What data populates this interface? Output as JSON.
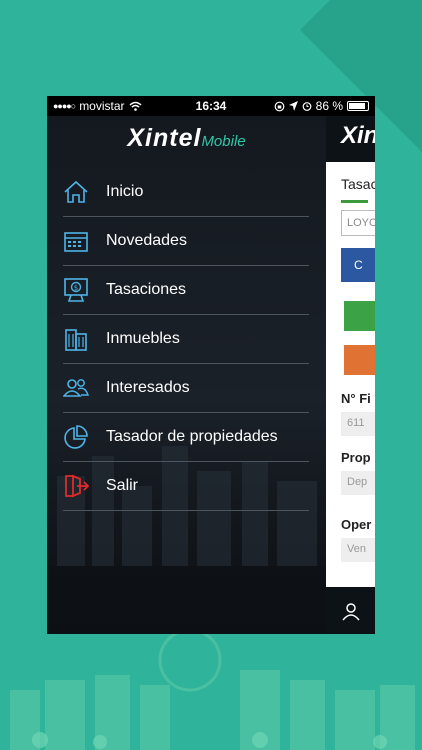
{
  "status_bar": {
    "signal_dots": "●●●●○",
    "carrier": "movistar",
    "time": "16:34",
    "battery_percent": "86 %"
  },
  "app": {
    "brand": "Xintel",
    "brand_sub": "Mobile"
  },
  "menu": {
    "items": [
      {
        "label": "Inicio",
        "icon": "home-icon"
      },
      {
        "label": "Novedades",
        "icon": "calendar-icon"
      },
      {
        "label": "Tasaciones",
        "icon": "appraisal-icon"
      },
      {
        "label": "Inmuebles",
        "icon": "building-icon"
      },
      {
        "label": "Interesados",
        "icon": "users-icon"
      },
      {
        "label": "Tasador de propiedades",
        "icon": "pie-chart-icon"
      },
      {
        "label": "Salir",
        "icon": "logout-icon"
      }
    ]
  },
  "background_panel": {
    "header_text": "Xin",
    "tab_label": "Tasac",
    "input_value": "LOYO",
    "blue_button_label": "C",
    "ficha_label": "N° Fi",
    "ficha_value": "611",
    "prop_label": "Prop",
    "prop_value": "Dep",
    "oper_label": "Oper",
    "oper_value": "Ven"
  },
  "colors": {
    "background": "#2fb39a",
    "accent": "#2fc7a6",
    "logout": "#e02b2b",
    "icon_stroke": "#4fb3e8"
  }
}
